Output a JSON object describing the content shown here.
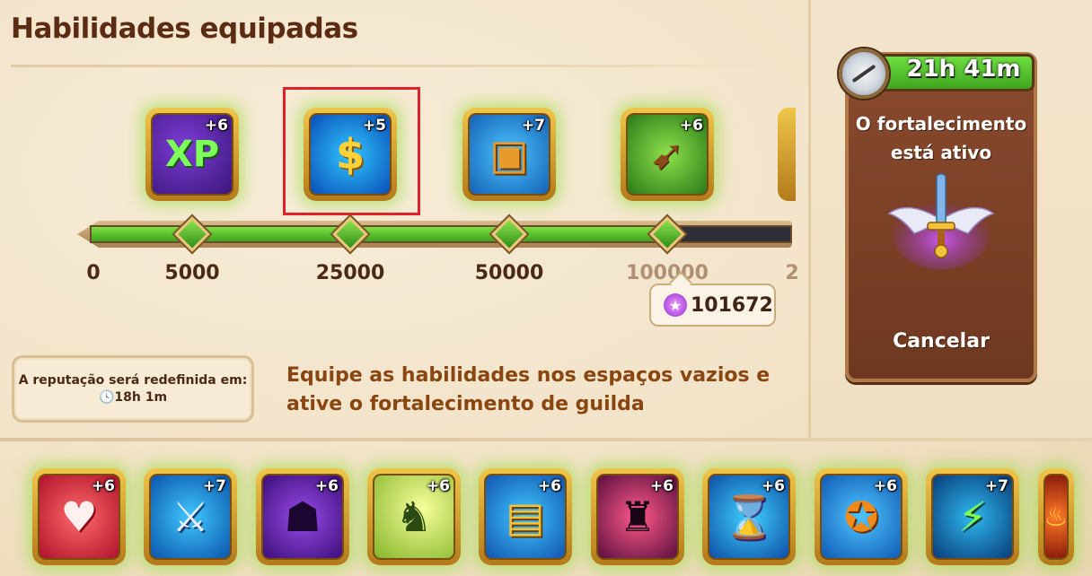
{
  "title": "Habilidades equipadas",
  "equipped_skills": [
    {
      "name": "xp-boost-icon",
      "bonus": "+6",
      "glyph": "XP"
    },
    {
      "name": "gold-coin-boost-icon",
      "bonus": "+5",
      "glyph": "$"
    },
    {
      "name": "treasure-chest-plus-icon",
      "bonus": "+7",
      "glyph": "▣"
    },
    {
      "name": "winged-boot-icon",
      "bonus": "+6",
      "glyph": "➹"
    }
  ],
  "progress": {
    "ticks": [
      "0",
      "5000",
      "25000",
      "50000",
      "100000",
      "2"
    ],
    "current_value": 101672,
    "current_display": "101672"
  },
  "reset": {
    "label": "A reputação será redefinida em:",
    "time": "🕓18h 1m"
  },
  "equip_hint": "Equipe as habilidades nos espaços vazios e ative o fortalecimento de guilda",
  "boost": {
    "timer": "21h 41m",
    "status": "O fortalecimento está ativo",
    "cancel": "Cancelar"
  },
  "available_skills": [
    {
      "name": "heart-boost-icon",
      "bonus": "+6",
      "glyph": "♥"
    },
    {
      "name": "sword-boost-icon",
      "bonus": "+7",
      "glyph": "⚔"
    },
    {
      "name": "shadow-figure-icon",
      "bonus": "+6",
      "glyph": "☗"
    },
    {
      "name": "knight-silhouette-icon",
      "bonus": "+6",
      "glyph": "♞"
    },
    {
      "name": "hero-card-icon",
      "bonus": "+6",
      "glyph": "▤"
    },
    {
      "name": "demon-silhouette-icon",
      "bonus": "+6",
      "glyph": "♜"
    },
    {
      "name": "hourglass-icon",
      "bonus": "+6",
      "glyph": "⌛"
    },
    {
      "name": "star-shield-icon",
      "bonus": "+6",
      "glyph": "✪"
    },
    {
      "name": "slash-warrior-icon",
      "bonus": "+7",
      "glyph": "⚡"
    },
    {
      "name": "fire-skill-icon",
      "bonus": "",
      "glyph": "♨"
    }
  ]
}
